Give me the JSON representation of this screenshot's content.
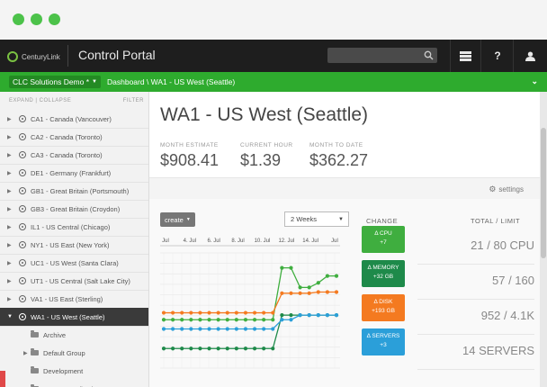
{
  "topbar": {
    "logo_text": "CenturyLink",
    "portal_title": "Control Portal"
  },
  "greenbar": {
    "account": "CLC Solutions Demo *",
    "breadcrumb": "Dashboard \\ WA1 - US West (Seattle)"
  },
  "sidebar": {
    "expand_collapse": "EXPAND | COLLAPSE",
    "filter": "FILTER",
    "items": [
      {
        "label": "CA1 - Canada (Vancouver)"
      },
      {
        "label": "CA2 - Canada (Toronto)"
      },
      {
        "label": "CA3 - Canada (Toronto)"
      },
      {
        "label": "DE1 - Germany (Frankfurt)"
      },
      {
        "label": "GB1 - Great Britain (Portsmouth)"
      },
      {
        "label": "GB3 - Great Britain (Croydon)"
      },
      {
        "label": "IL1 - US Central (Chicago)"
      },
      {
        "label": "NY1 - US East (New York)"
      },
      {
        "label": "UC1 - US West (Santa Clara)"
      },
      {
        "label": "UT1 - US Central (Salt Lake City)"
      },
      {
        "label": "VA1 - US East (Sterling)"
      },
      {
        "label": "WA1 - US West (Seattle)"
      }
    ],
    "subitems": [
      {
        "label": "Archive"
      },
      {
        "label": "Default Group"
      },
      {
        "label": "Development"
      },
      {
        "label": "Intranet Applications"
      }
    ]
  },
  "main": {
    "title": "WA1 - US West (Seattle)",
    "stats": [
      {
        "label": "MONTH ESTIMATE",
        "value": "$908.41"
      },
      {
        "label": "CURRENT HOUR",
        "value": "$1.39"
      },
      {
        "label": "MONTH TO DATE",
        "value": "$362.27"
      }
    ],
    "settings_label": "settings",
    "create_label": "create",
    "period_select": "2 Weeks",
    "change_header": "CHANGE",
    "total_header": "TOTAL / LIMIT",
    "changes": [
      {
        "label": "Δ CPU",
        "value": "+7",
        "color": "#3fae3f"
      },
      {
        "label": "Δ MEMORY",
        "value": "+32 GB",
        "color": "#1e8a4a"
      },
      {
        "label": "Δ DISK",
        "value": "+193 GB",
        "color": "#f47a20"
      },
      {
        "label": "Δ SERVERS",
        "value": "+3",
        "color": "#2b9fd9"
      }
    ],
    "totals": [
      {
        "value": "21 / 80 CPU"
      },
      {
        "value": "57 / 160"
      },
      {
        "value": "952 / 4.1K"
      },
      {
        "value": "14 SERVERS"
      }
    ]
  },
  "chart_data": {
    "type": "line",
    "categories": [
      "Jul",
      "4. Jul",
      "6. Jul",
      "8. Jul",
      "10. Jul",
      "12. Jul",
      "14. Jul",
      "Jul"
    ],
    "series": [
      {
        "color": "#3fae3f",
        "values": [
          0.42,
          0.42,
          0.42,
          0.42,
          0.42,
          0.42,
          0.42,
          0.42,
          0.42,
          0.42,
          0.42,
          0.42,
          0.42,
          0.87,
          0.87,
          0.7,
          0.7,
          0.74,
          0.8,
          0.8
        ]
      },
      {
        "color": "#f47a20",
        "values": [
          0.48,
          0.48,
          0.48,
          0.48,
          0.48,
          0.48,
          0.48,
          0.48,
          0.48,
          0.48,
          0.48,
          0.48,
          0.48,
          0.65,
          0.65,
          0.65,
          0.65,
          0.66,
          0.66,
          0.66
        ]
      },
      {
        "color": "#1e8a4a",
        "values": [
          0.17,
          0.17,
          0.17,
          0.17,
          0.17,
          0.17,
          0.17,
          0.17,
          0.17,
          0.17,
          0.17,
          0.17,
          0.17,
          0.46,
          0.46,
          0.46,
          0.46,
          0.46,
          0.46,
          0.46
        ]
      },
      {
        "color": "#2b9fd9",
        "values": [
          0.34,
          0.34,
          0.34,
          0.34,
          0.34,
          0.34,
          0.34,
          0.34,
          0.34,
          0.34,
          0.34,
          0.34,
          0.34,
          0.42,
          0.42,
          0.46,
          0.46,
          0.46,
          0.46,
          0.46
        ]
      }
    ],
    "ylim": [
      0,
      1
    ]
  }
}
